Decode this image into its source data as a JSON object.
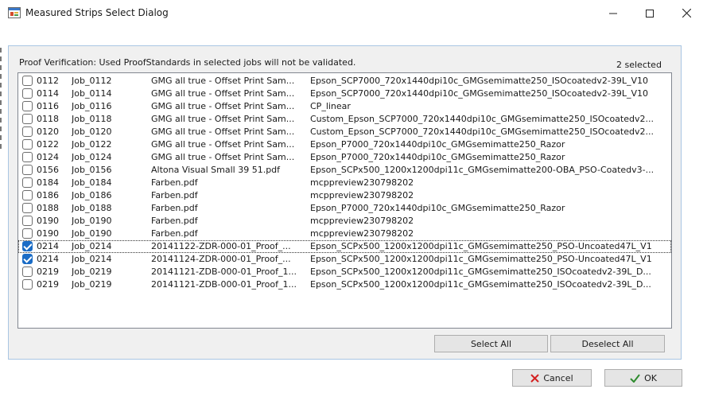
{
  "window": {
    "title": "Measured Strips Select Dialog"
  },
  "header": {
    "info_text": "Proof Verification: Used ProofStandards in selected jobs will not be validated.",
    "selected_count": "2 selected"
  },
  "rows": [
    {
      "num": "0112",
      "job": "Job_0112",
      "file": "GMG all true - Offset Print Sam...",
      "profile": "Epson_SCP7000_720x1440dpi10c_GMGsemimatte250_ISOcoatedv2-39L_V10",
      "checked": false
    },
    {
      "num": "0114",
      "job": "Job_0114",
      "file": "GMG all true - Offset Print Sam...",
      "profile": "Epson_SCP7000_720x1440dpi10c_GMGsemimatte250_ISOcoatedv2-39L_V10",
      "checked": false
    },
    {
      "num": "0116",
      "job": "Job_0116",
      "file": "GMG all true - Offset Print Sam...",
      "profile": "CP_linear",
      "checked": false
    },
    {
      "num": "0118",
      "job": "Job_0118",
      "file": "GMG all true - Offset Print Sam...",
      "profile": "Custom_Epson_SCP7000_720x1440dpi10c_GMGsemimatte250_ISOcoatedv2...",
      "checked": false
    },
    {
      "num": "0120",
      "job": "Job_0120",
      "file": "GMG all true - Offset Print Sam...",
      "profile": "Custom_Epson_SCP7000_720x1440dpi10c_GMGsemimatte250_ISOcoatedv2...",
      "checked": false
    },
    {
      "num": "0122",
      "job": "Job_0122",
      "file": "GMG all true - Offset Print Sam...",
      "profile": "Epson_P7000_720x1440dpi10c_GMGsemimatte250_Razor",
      "checked": false
    },
    {
      "num": "0124",
      "job": "Job_0124",
      "file": "GMG all true - Offset Print Sam...",
      "profile": "Epson_P7000_720x1440dpi10c_GMGsemimatte250_Razor",
      "checked": false
    },
    {
      "num": "0156",
      "job": "Job_0156",
      "file": "Altona Visual Small 39 51.pdf",
      "profile": "Epson_SCPx500_1200x1200dpi11c_GMGsemimatte200-OBA_PSO-Coatedv3-...",
      "checked": false
    },
    {
      "num": "0184",
      "job": "Job_0184",
      "file": "Farben.pdf",
      "profile": "mcppreview230798202",
      "checked": false
    },
    {
      "num": "0186",
      "job": "Job_0186",
      "file": "Farben.pdf",
      "profile": "mcppreview230798202",
      "checked": false
    },
    {
      "num": "0188",
      "job": "Job_0188",
      "file": "Farben.pdf",
      "profile": "Epson_P7000_720x1440dpi10c_GMGsemimatte250_Razor",
      "checked": false
    },
    {
      "num": "0190",
      "job": "Job_0190",
      "file": "Farben.pdf",
      "profile": "mcppreview230798202",
      "checked": false
    },
    {
      "num": "0190",
      "job": "Job_0190",
      "file": "Farben.pdf",
      "profile": "mcppreview230798202",
      "checked": false
    },
    {
      "num": "0214",
      "job": "Job_0214",
      "file": "20141122-ZDR-000-01_Proof_...",
      "profile": "Epson_SCPx500_1200x1200dpi11c_GMGsemimatte250_PSO-Uncoated47L_V1",
      "checked": true,
      "focused": true
    },
    {
      "num": "0214",
      "job": "Job_0214",
      "file": "20141124-ZDR-000-01_Proof_...",
      "profile": "Epson_SCPx500_1200x1200dpi11c_GMGsemimatte250_PSO-Uncoated47L_V1",
      "checked": true
    },
    {
      "num": "0219",
      "job": "Job_0219",
      "file": "20141121-ZDB-000-01_Proof_1...",
      "profile": "Epson_SCPx500_1200x1200dpi11c_GMGsemimatte250_ISOcoatedv2-39L_D...",
      "checked": false
    },
    {
      "num": "0219",
      "job": "Job_0219",
      "file": "20141121-ZDB-000-01_Proof_1...",
      "profile": "Epson_SCPx500_1200x1200dpi11c_GMGsemimatte250_ISOcoatedv2-39L_D...",
      "checked": false
    }
  ],
  "buttons": {
    "select_all": "Select All",
    "deselect_all": "Deselect All",
    "cancel": "Cancel",
    "ok": "OK"
  },
  "icons": {
    "app": "app-window-icon",
    "minimize": "minimize-icon",
    "maximize": "maximize-icon",
    "close": "close-icon",
    "cancel": "cancel-x-icon",
    "ok": "checkmark-icon"
  },
  "colors": {
    "checkbox_checked": "#1a6cc6",
    "cancel_icon": "#d32020",
    "ok_icon": "#2e8b2e",
    "panel_border": "#a9c6e3"
  }
}
